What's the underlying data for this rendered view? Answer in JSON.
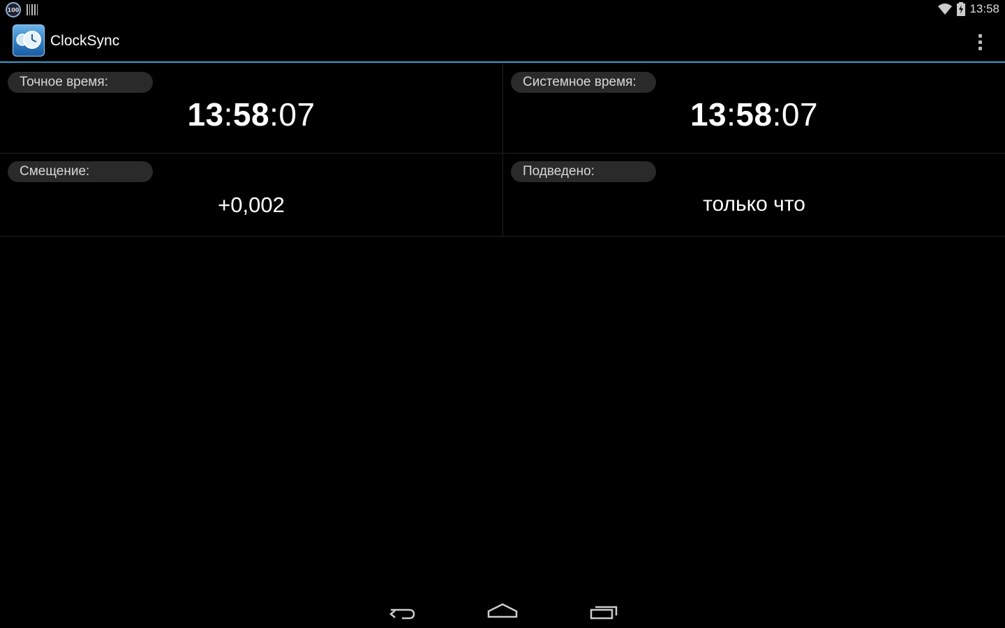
{
  "status_bar": {
    "badge_text": "100",
    "time": "13:58",
    "icons": [
      "notification-badge-icon",
      "barcode-icon",
      "wifi-icon",
      "battery-icon"
    ]
  },
  "action_bar": {
    "title": "ClockSync",
    "accent_color": "#33a0d4",
    "icons": [
      "clocksync-app-icon",
      "overflow-menu-icon"
    ]
  },
  "cards": {
    "exact_time": {
      "label": "Точное время:",
      "hours": "13",
      "minutes": "58",
      "seconds": "07"
    },
    "system_time": {
      "label": "Системное время:",
      "hours": "13",
      "minutes": "58",
      "seconds": "07"
    },
    "offset": {
      "label": "Смещение:",
      "value": "+0,002"
    },
    "synced": {
      "label": "Подведено:",
      "value": "только что"
    }
  },
  "nav_bar": {
    "icons": [
      "back-icon",
      "home-icon",
      "recent-apps-icon"
    ]
  }
}
